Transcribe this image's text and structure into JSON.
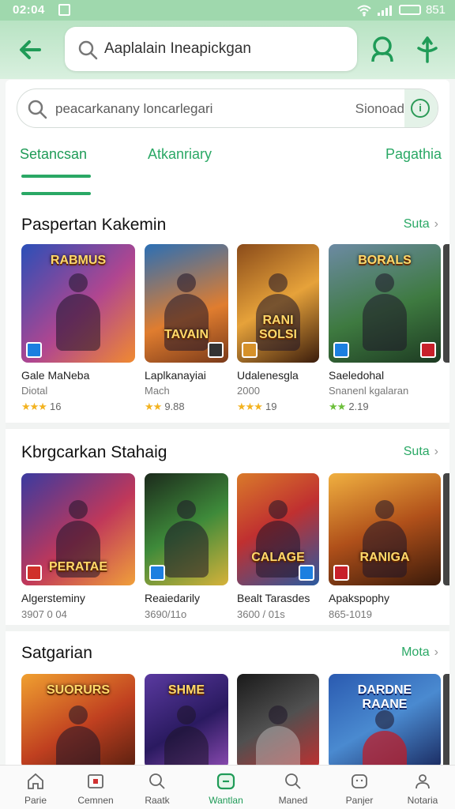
{
  "status_bar": {
    "time": "02:04",
    "battery": "851"
  },
  "header": {
    "search_query": "Aaplalain Ineapickgan"
  },
  "inner_search": {
    "placeholder": "peacarkanany loncarlegari",
    "button_label": "Sionoad"
  },
  "tabs": [
    {
      "label": "Setancsan"
    },
    {
      "label": "Atkanriary"
    },
    {
      "label": "Pagathia"
    }
  ],
  "sections": [
    {
      "title": "Paspertan Kakemin",
      "more": "Suta",
      "items": [
        {
          "name": "Gale MaNeba",
          "sub": "Diotal",
          "rating": "16",
          "logo": "RABMUS"
        },
        {
          "name": "Laplkanayiai",
          "sub": "Mach",
          "rating": "9.88",
          "logo": "TAVAIN"
        },
        {
          "name": "Udalenesgla",
          "sub": "2000",
          "rating": "19",
          "logo": "RANI SOLSI"
        },
        {
          "name": "Saeledohal",
          "sub": "Snanenl kgalaran",
          "rating": "2.19",
          "logo": "BORALS"
        }
      ]
    },
    {
      "title": "Kbrgcarkan Stahaig",
      "more": "Suta",
      "items": [
        {
          "name": "Algersteminy",
          "sub": "3907 0 04",
          "logo": "PERATAE"
        },
        {
          "name": "Reaiedarily",
          "sub": "3690/11o",
          "logo": ""
        },
        {
          "name": "Bealt Tarasdes",
          "sub": "3600 / 01s",
          "logo": "CALAGE"
        },
        {
          "name": "Apakspophy",
          "sub": "865-1019",
          "logo": "RANIGA"
        }
      ]
    },
    {
      "title": "Satgarian",
      "more": "Mota",
      "items": [
        {
          "name": "",
          "sub": "",
          "logo": "SUORURS"
        },
        {
          "name": "",
          "sub": "",
          "logo": "SHME"
        },
        {
          "name": "",
          "sub": "",
          "logo": ""
        },
        {
          "name": "",
          "sub": "",
          "logo": "DARDNE RAANE"
        }
      ]
    }
  ],
  "bottom_nav": [
    {
      "label": "Parie",
      "icon": "home-icon"
    },
    {
      "label": "Cemnen",
      "icon": "apps-icon"
    },
    {
      "label": "Raatk",
      "icon": "search-icon"
    },
    {
      "label": "Wantlan",
      "icon": "games-icon"
    },
    {
      "label": "Maned",
      "icon": "search-icon"
    },
    {
      "label": "Panjer",
      "icon": "library-icon"
    },
    {
      "label": "Notaria",
      "icon": "profile-icon"
    }
  ],
  "colors": {
    "accent": "#2aa865",
    "header_bg": "#b8e3c3"
  }
}
